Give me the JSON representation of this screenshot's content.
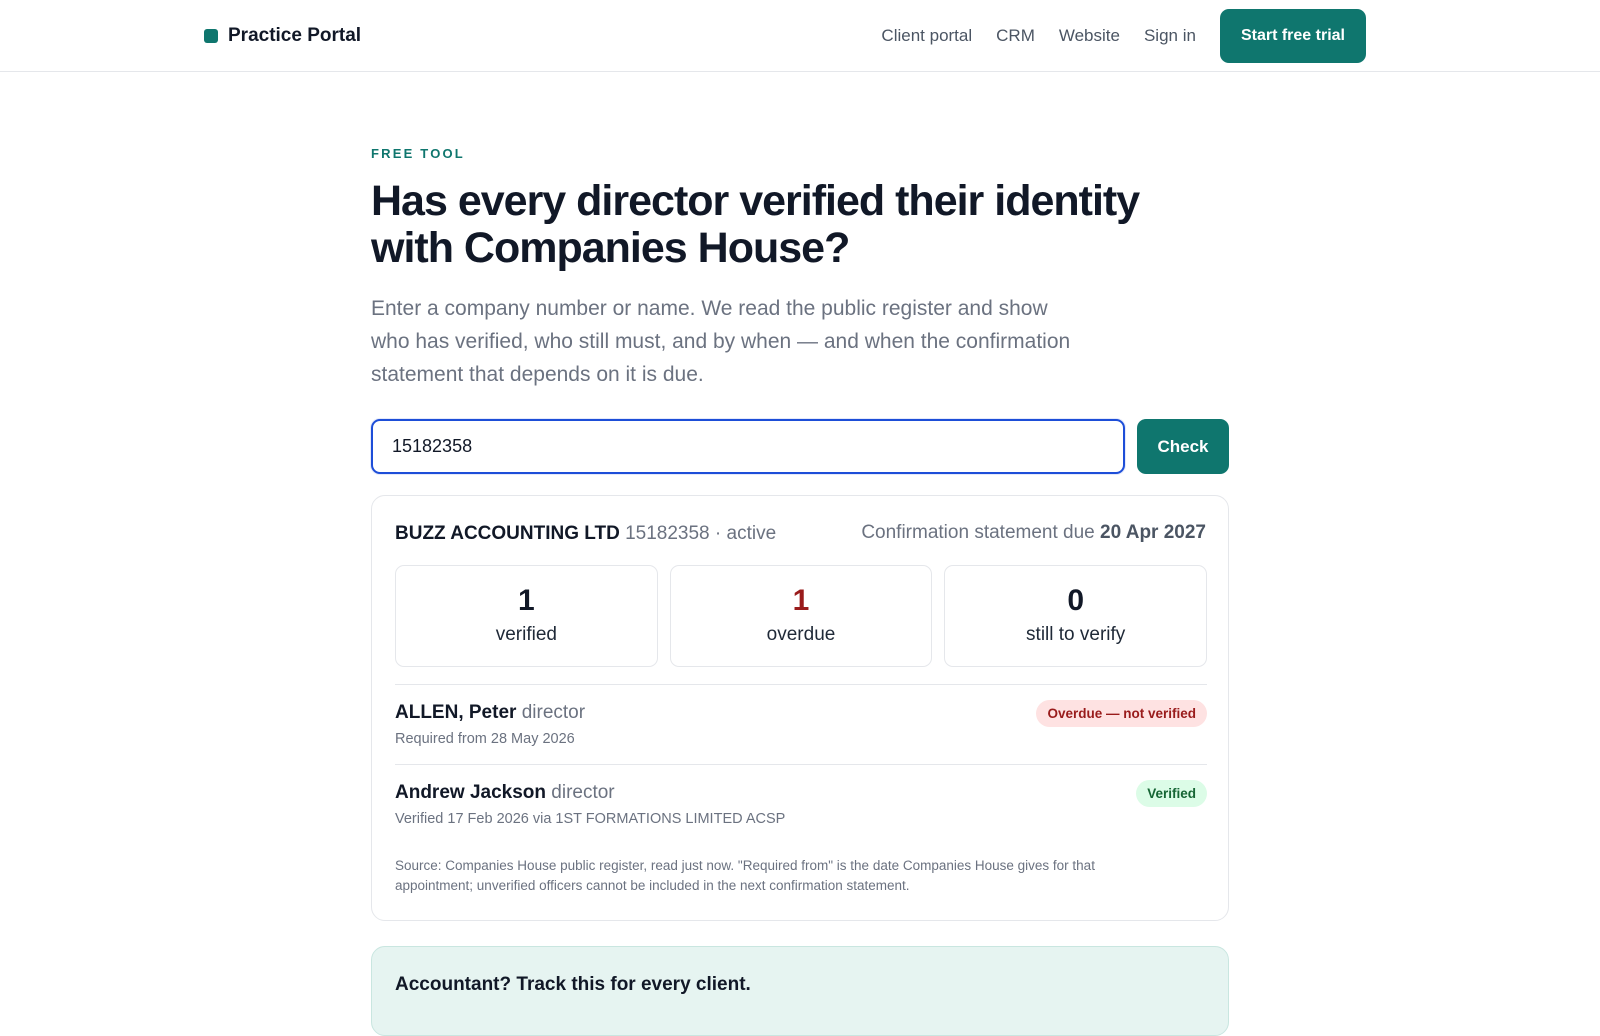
{
  "header": {
    "brand": "Practice Portal",
    "nav": [
      "Client portal",
      "CRM",
      "Website",
      "Sign in"
    ],
    "cta": "Start free trial"
  },
  "hero": {
    "eyebrow": "FREE TOOL",
    "headline": "Has every director verified their identity with Companies House?",
    "lede": "Enter a company number or name. We read the public register and show who has verified, who still must, and by when — and when the confirmation statement that depends on it is due."
  },
  "search": {
    "value": "15182358",
    "button": "Check"
  },
  "result": {
    "company_name": "BUZZ ACCOUNTING LTD",
    "company_meta": "15182358 · active",
    "cs_label": "Confirmation statement due",
    "cs_date": "20 Apr 2027",
    "stats": [
      {
        "value": "1",
        "label": "verified"
      },
      {
        "value": "1",
        "label": "overdue"
      },
      {
        "value": "0",
        "label": "still to verify"
      }
    ],
    "officers": [
      {
        "name": "ALLEN, Peter",
        "role": "director",
        "detail": "Required from 28 May 2026",
        "status": "Overdue — not verified"
      },
      {
        "name": "Andrew Jackson",
        "role": "director",
        "detail": "Verified 17 Feb 2026 via 1ST FORMATIONS LIMITED ACSP",
        "status": "Verified"
      }
    ],
    "source_note": "Source: Companies House public register, read just now. \"Required from\" is the date Companies House gives for that appointment; unverified officers cannot be included in the next confirmation statement."
  },
  "cta_card": {
    "title": "Accountant? Track this for every client."
  },
  "colors": {
    "accent": "#0f766e",
    "focus": "#1d4ed8",
    "danger": "#991b1b",
    "success": "#166534"
  }
}
